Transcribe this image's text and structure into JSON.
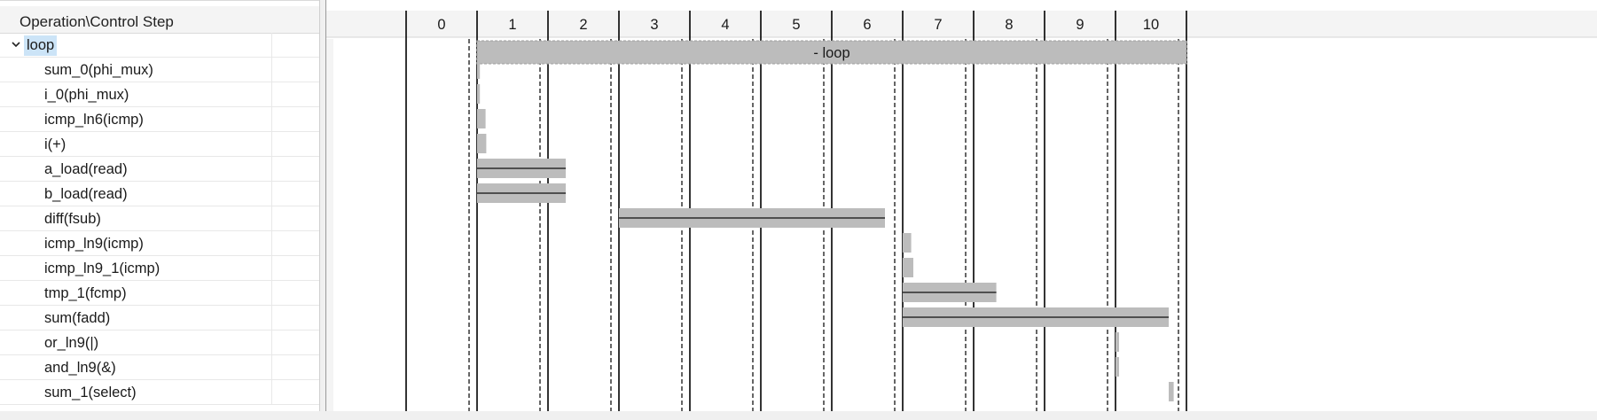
{
  "header": {
    "title": "Operation\\Control Step"
  },
  "loop": {
    "label": "loop",
    "bar_label": "- loop",
    "expanded": true,
    "start_step": 1,
    "end_step": 10
  },
  "control_steps": [
    "0",
    "1",
    "2",
    "3",
    "4",
    "5",
    "6",
    "7",
    "8",
    "9",
    "10"
  ],
  "operations": [
    {
      "label": "sum_0(phi_mux)",
      "start_step": 1,
      "start_frac": 0.0,
      "end_step": 1,
      "end_frac": 0.04,
      "multi": false
    },
    {
      "label": "i_0(phi_mux)",
      "start_step": 1,
      "start_frac": 0.0,
      "end_step": 1,
      "end_frac": 0.04,
      "multi": false
    },
    {
      "label": "icmp_ln6(icmp)",
      "start_step": 1,
      "start_frac": 0.0,
      "end_step": 1,
      "end_frac": 0.12,
      "multi": false
    },
    {
      "label": "i(+)",
      "start_step": 1,
      "start_frac": 0.0,
      "end_step": 1,
      "end_frac": 0.13,
      "multi": false
    },
    {
      "label": "a_load(read)",
      "start_step": 1,
      "start_frac": 0.0,
      "end_step": 2,
      "end_frac": 0.25,
      "multi": true
    },
    {
      "label": "b_load(read)",
      "start_step": 1,
      "start_frac": 0.0,
      "end_step": 2,
      "end_frac": 0.25,
      "multi": true
    },
    {
      "label": "diff(fsub)",
      "start_step": 3,
      "start_frac": 0.0,
      "end_step": 6,
      "end_frac": 0.75,
      "multi": true
    },
    {
      "label": "icmp_ln9(icmp)",
      "start_step": 7,
      "start_frac": 0.0,
      "end_step": 7,
      "end_frac": 0.12,
      "multi": false
    },
    {
      "label": "icmp_ln9_1(icmp)",
      "start_step": 7,
      "start_frac": 0.0,
      "end_step": 7,
      "end_frac": 0.15,
      "multi": false
    },
    {
      "label": "tmp_1(fcmp)",
      "start_step": 7,
      "start_frac": 0.0,
      "end_step": 8,
      "end_frac": 0.32,
      "multi": true
    },
    {
      "label": "sum(fadd)",
      "start_step": 7,
      "start_frac": 0.0,
      "end_step": 10,
      "end_frac": 0.75,
      "multi": true
    },
    {
      "label": "or_ln9(|)",
      "start_step": 10,
      "start_frac": 0.0,
      "end_step": 10,
      "end_frac": 0.05,
      "multi": false
    },
    {
      "label": "and_ln9(&)",
      "start_step": 10,
      "start_frac": 0.0,
      "end_step": 10,
      "end_frac": 0.05,
      "multi": false
    },
    {
      "label": "sum_1(select)",
      "start_step": 10,
      "start_frac": 0.75,
      "end_step": 10,
      "end_frac": 0.82,
      "multi": false
    }
  ],
  "colors": {
    "bar": "#bcbcbc",
    "bar_line": "#2b2b2b",
    "grid_line": "#000000",
    "selection": "#cce4f7",
    "header_bg": "#f4f4f4"
  },
  "icons": {
    "expand": "chevron-down-icon"
  }
}
